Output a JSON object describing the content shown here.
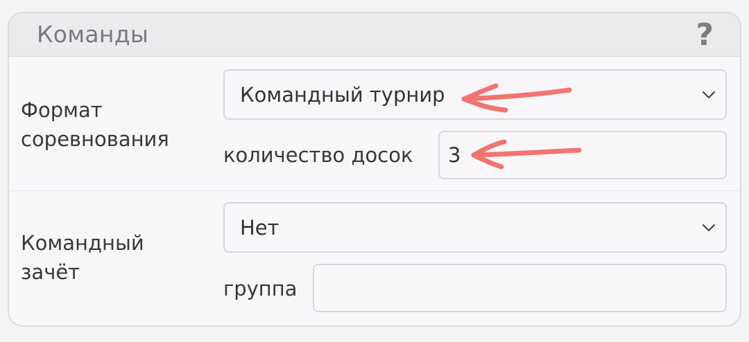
{
  "card": {
    "title": "Команды",
    "help_symbol": "?"
  },
  "format": {
    "label": "Формат соревнования",
    "select_value": "Командный турнир",
    "boards_label": "количество досок",
    "boards_value": "3"
  },
  "team_scoring": {
    "label": "Командный зачёт",
    "select_value": "Нет",
    "group_label": "группа",
    "group_value": ""
  },
  "icons": {
    "help": "question-mark-icon",
    "dropdown": "chevron-down-icon",
    "annotation": "red-arrow-icon"
  },
  "colors": {
    "annotation": "#f07470",
    "header_bg": "#ebebee",
    "border": "#d8d6db"
  }
}
